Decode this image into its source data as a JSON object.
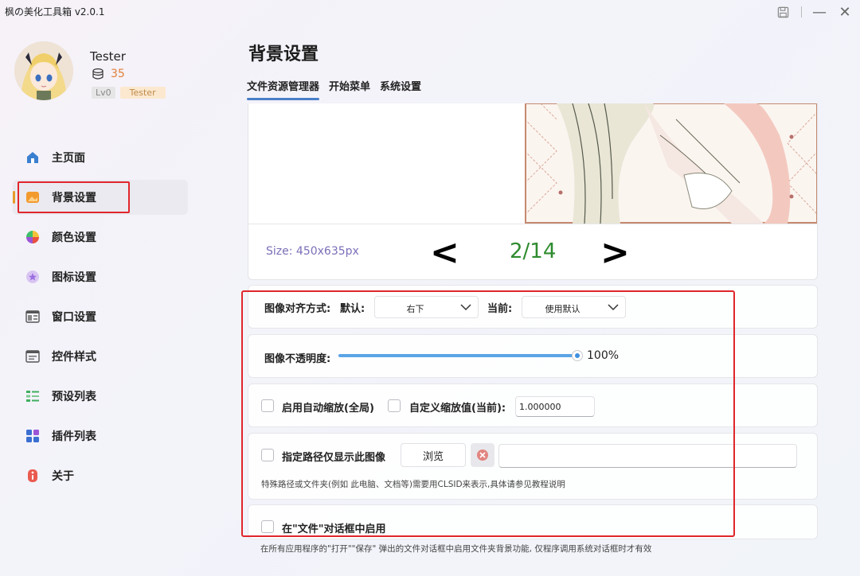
{
  "app": {
    "title": "枫の美化工具箱 v2.0.1",
    "save_icon": "save-icon",
    "minimize_glyph": "—",
    "close_glyph": "✕"
  },
  "user": {
    "name": "Tester",
    "coins": "35",
    "level": "Lv0",
    "tag": "Tester"
  },
  "sidebar": {
    "items": [
      {
        "label": "主页面",
        "icon": "home-icon"
      },
      {
        "label": "背景设置",
        "icon": "background-image-icon",
        "active": true
      },
      {
        "label": "颜色设置",
        "icon": "color-wheel-icon"
      },
      {
        "label": "图标设置",
        "icon": "star-icon"
      },
      {
        "label": "窗口设置",
        "icon": "window-icon"
      },
      {
        "label": "控件样式",
        "icon": "widget-icon"
      },
      {
        "label": "预设列表",
        "icon": "list-icon"
      },
      {
        "label": "插件列表",
        "icon": "plugin-grid-icon"
      },
      {
        "label": "关于",
        "icon": "info-icon"
      }
    ]
  },
  "main": {
    "title": "背景设置",
    "tabs": [
      "文件资源管理器",
      "开始菜单",
      "系统设置"
    ],
    "preview": {
      "size": "Size: 450x635px",
      "prev": "<",
      "counter": "2/14",
      "next": ">"
    },
    "alignment": {
      "label": "图像对齐方式:",
      "default_label": "默认:",
      "default_value": "右下",
      "current_label": "当前:",
      "current_value": "使用默认"
    },
    "opacity": {
      "label": "图像不透明度:",
      "value_text": "100%",
      "value": 1.0
    },
    "scaling": {
      "auto_label": "启用自动缩放(全局)",
      "custom_label": "自定义缩放值(当前):",
      "custom_value": "1.000000"
    },
    "path": {
      "label": "指定路径仅显示此图像",
      "browse": "浏览",
      "value": "",
      "hint": "特殊路径或文件夹(例如 此电脑、文档等)需要用CLSID来表示,具体请参见教程说明"
    },
    "file_dialog": {
      "label": "在\"文件\"对话框中启用",
      "hint": "在所有应用程序的\"打开\"\"保存\" 弹出的文件对话框中启用文件夹背景功能, 仅程序调用系统对话框时才有效"
    }
  },
  "colors": {
    "accent": "#4a7fc7",
    "counter": "#2e8b2e",
    "size_text": "#7a6fb8",
    "highlight": "#e0262b",
    "coins": "#e0803a"
  }
}
